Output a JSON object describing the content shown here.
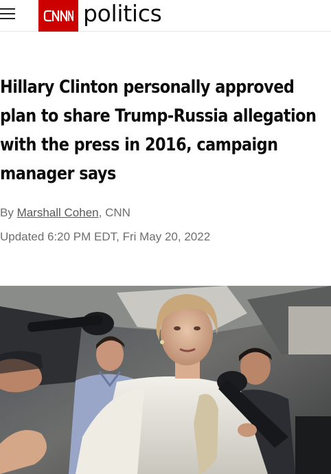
{
  "header": {
    "menu_icon": "hamburger-menu-icon",
    "logo_text": "CNN",
    "section": "politics",
    "brand_color": "#cc0000"
  },
  "article": {
    "headline": "Hillary Clinton personally approved plan to share Trump-Russia allegation with the press in 2016, campaign manager says",
    "byline_prefix": "By ",
    "author": "Marshall Cohen",
    "byline_suffix": ", CNN",
    "updated": "Updated 6:20 PM EDT, Fri May 20, 2022"
  }
}
